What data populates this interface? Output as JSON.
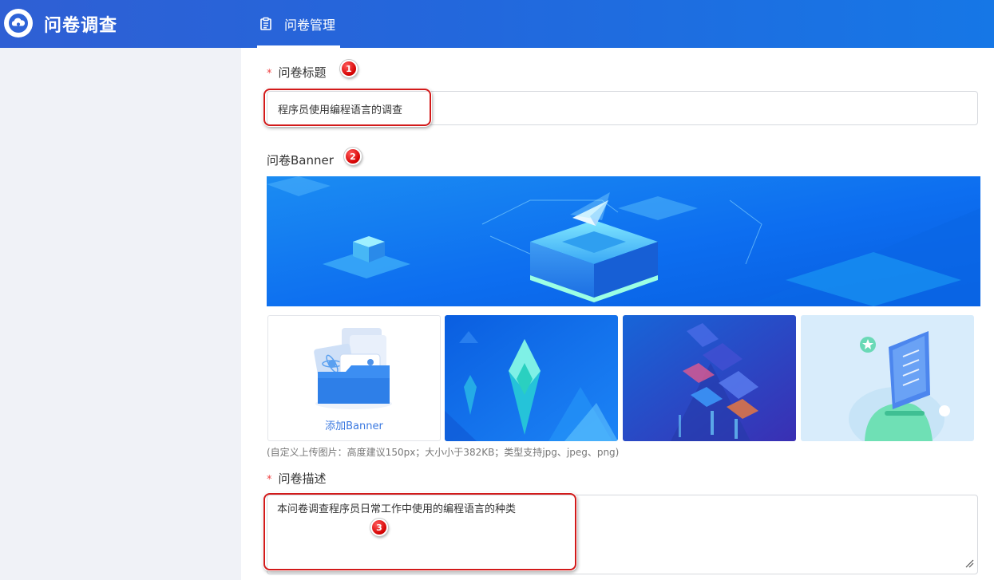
{
  "header": {
    "app_title": "问卷调查",
    "nav_tab_label": "问卷管理"
  },
  "form": {
    "title_label": "问卷标题",
    "required_mark": "*",
    "title_value": "程序员使用编程语言的调查",
    "banner_label": "问卷Banner",
    "add_banner_label": "添加Banner",
    "upload_hint": "(自定义上传图片：高度建议150px；大小小于382KB；类型支持jpg、jpeg、png)",
    "description_label": "问卷描述",
    "description_value": "本问卷调查程序员日常工作中使用的编程语言的种类"
  },
  "markers": [
    "1",
    "2",
    "3"
  ],
  "icons": {
    "logo": "cloud-logo-icon",
    "nav": "clipboard-icon",
    "add_banner": "image-folder-icon",
    "resize": "resize-handle-icon"
  },
  "colors": {
    "header_start": "#2f5fd4",
    "header_end": "#1677e6",
    "sidebar_bg": "#f0f2f7",
    "required": "#f04545",
    "marker": "#d40000",
    "link": "#3a78e0"
  }
}
